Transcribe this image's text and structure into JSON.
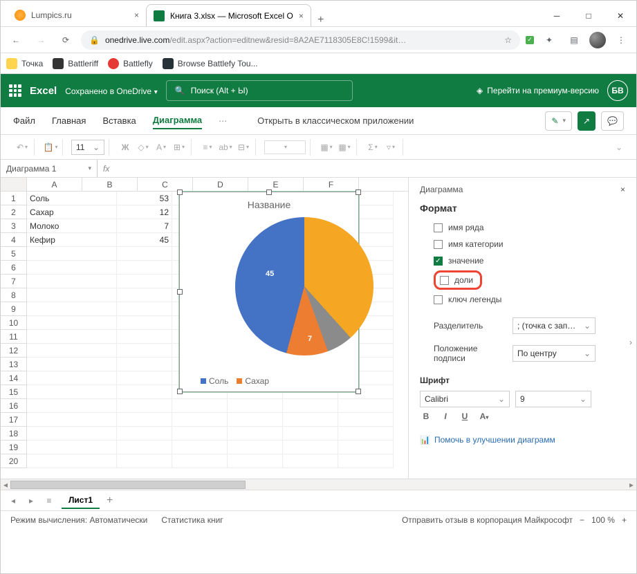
{
  "browser": {
    "tab1": {
      "title": "Lumpics.ru"
    },
    "tab2": {
      "title": "Книга 3.xlsx — Microsoft Excel O"
    },
    "url_host": "onedrive.live.com",
    "url_path": "/edit.aspx?action=editnew&resid=8A2AE7118305E8C!1599&it…",
    "bookmarks": [
      "Точка",
      "Battleriff",
      "Battlefly",
      "Browse Battlefy Tou..."
    ]
  },
  "excel": {
    "app": "Excel",
    "saved": "Сохранено в OneDrive",
    "search_placeholder": "Поиск (Alt + Ы)",
    "premium": "Перейти на премиум-версию",
    "user_initials": "БВ"
  },
  "ribbon": {
    "tabs": [
      "Файл",
      "Главная",
      "Вставка",
      "Диаграмма"
    ],
    "active_idx": 3,
    "open_in": "Открыть в классическом приложении",
    "font_size_box": "11"
  },
  "namebox": "Диаграмма 1",
  "fx": "fx",
  "columns": [
    "A",
    "B",
    "C",
    "D",
    "E",
    "F"
  ],
  "data": [
    {
      "a": "Соль",
      "b": "53"
    },
    {
      "a": "Сахар",
      "b": "12"
    },
    {
      "a": "Молоко",
      "b": "7"
    },
    {
      "a": "Кефир",
      "b": "45"
    }
  ],
  "chart_data": {
    "type": "pie",
    "title": "Название",
    "categories": [
      "Соль",
      "Сахар",
      "Молоко",
      "Кефир"
    ],
    "values": [
      53,
      12,
      7,
      45
    ],
    "colors": [
      "#4472c4",
      "#ed7d31",
      "#8b8b8b",
      "#f5a623"
    ],
    "labels_shown": [
      "45",
      "7"
    ],
    "legend_visible": [
      "Соль",
      "Сахар"
    ]
  },
  "panel": {
    "title": "Диаграмма",
    "section": "Формат",
    "opts": {
      "series_name": "имя ряда",
      "category_name": "имя категории",
      "value": "значение",
      "percent": "доли",
      "legend_key": "ключ легенды"
    },
    "separator_label": "Разделитель",
    "separator_value": "; (точка с зап…",
    "position_label": "Положение подписи",
    "position_value": "По центру",
    "font_label": "Шрифт",
    "font_name": "Calibri",
    "font_size": "9",
    "help": "Помочь в улучшении диаграмм"
  },
  "sheet_tab": "Лист1",
  "status": {
    "calc": "Режим вычисления: Автоматически",
    "stats": "Статистика книг",
    "feedback": "Отправить отзыв в корпорация Майкрософт",
    "zoom": "100 %"
  }
}
